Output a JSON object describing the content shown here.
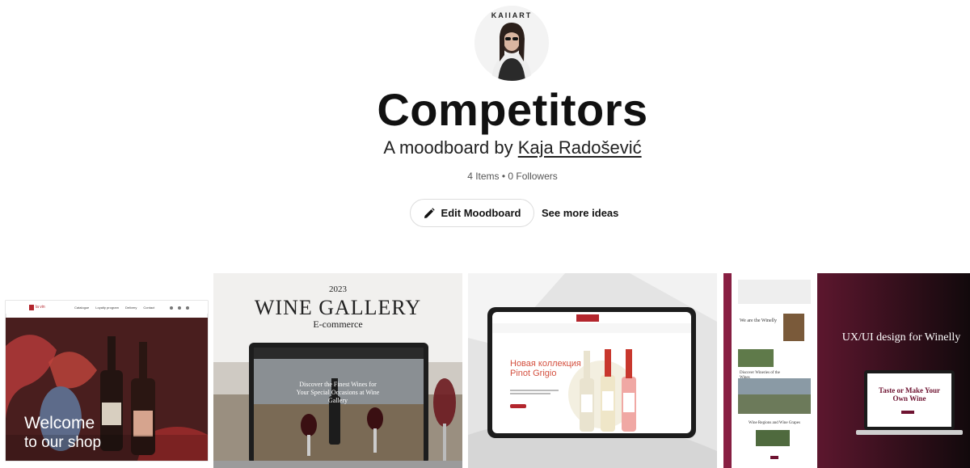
{
  "board": {
    "avatar_brand": "KAIIART",
    "title": "Competitors",
    "subtitle_prefix": "A moodboard by ",
    "author": "Kaja Radošević",
    "stats": "4 Items • 0 Followers"
  },
  "actions": {
    "edit_label": "Edit Moodboard",
    "see_more_label": "See more ideas"
  },
  "tiles": [
    {
      "brand": "la vin",
      "nav": [
        "Catalogue",
        "Loyalty program",
        "Delivery",
        "Contact"
      ],
      "headline_1": "Welcome",
      "headline_2": "to our shop"
    },
    {
      "year": "2023",
      "title": "WINE GALLERY",
      "subtitle": "E-commerce",
      "screen_text": "Discover the Finest Wines for Your Special Occasions at Wine Gallery"
    },
    {
      "headline": "Новая коллекция",
      "subheadline": "Pinot Grigio"
    },
    {
      "heading": "UX/UI design for Winelly",
      "screen_title": "Taste or Make Your Own Wine",
      "we_are": "We are the Winelly",
      "discover": "Discover Wineries of the Wines",
      "regions": "Wine Regions and Wine Grapes"
    }
  ],
  "colors": {
    "wine_dark": "#6e1331",
    "accent_red": "#b3262d",
    "title_text": "#111111"
  }
}
